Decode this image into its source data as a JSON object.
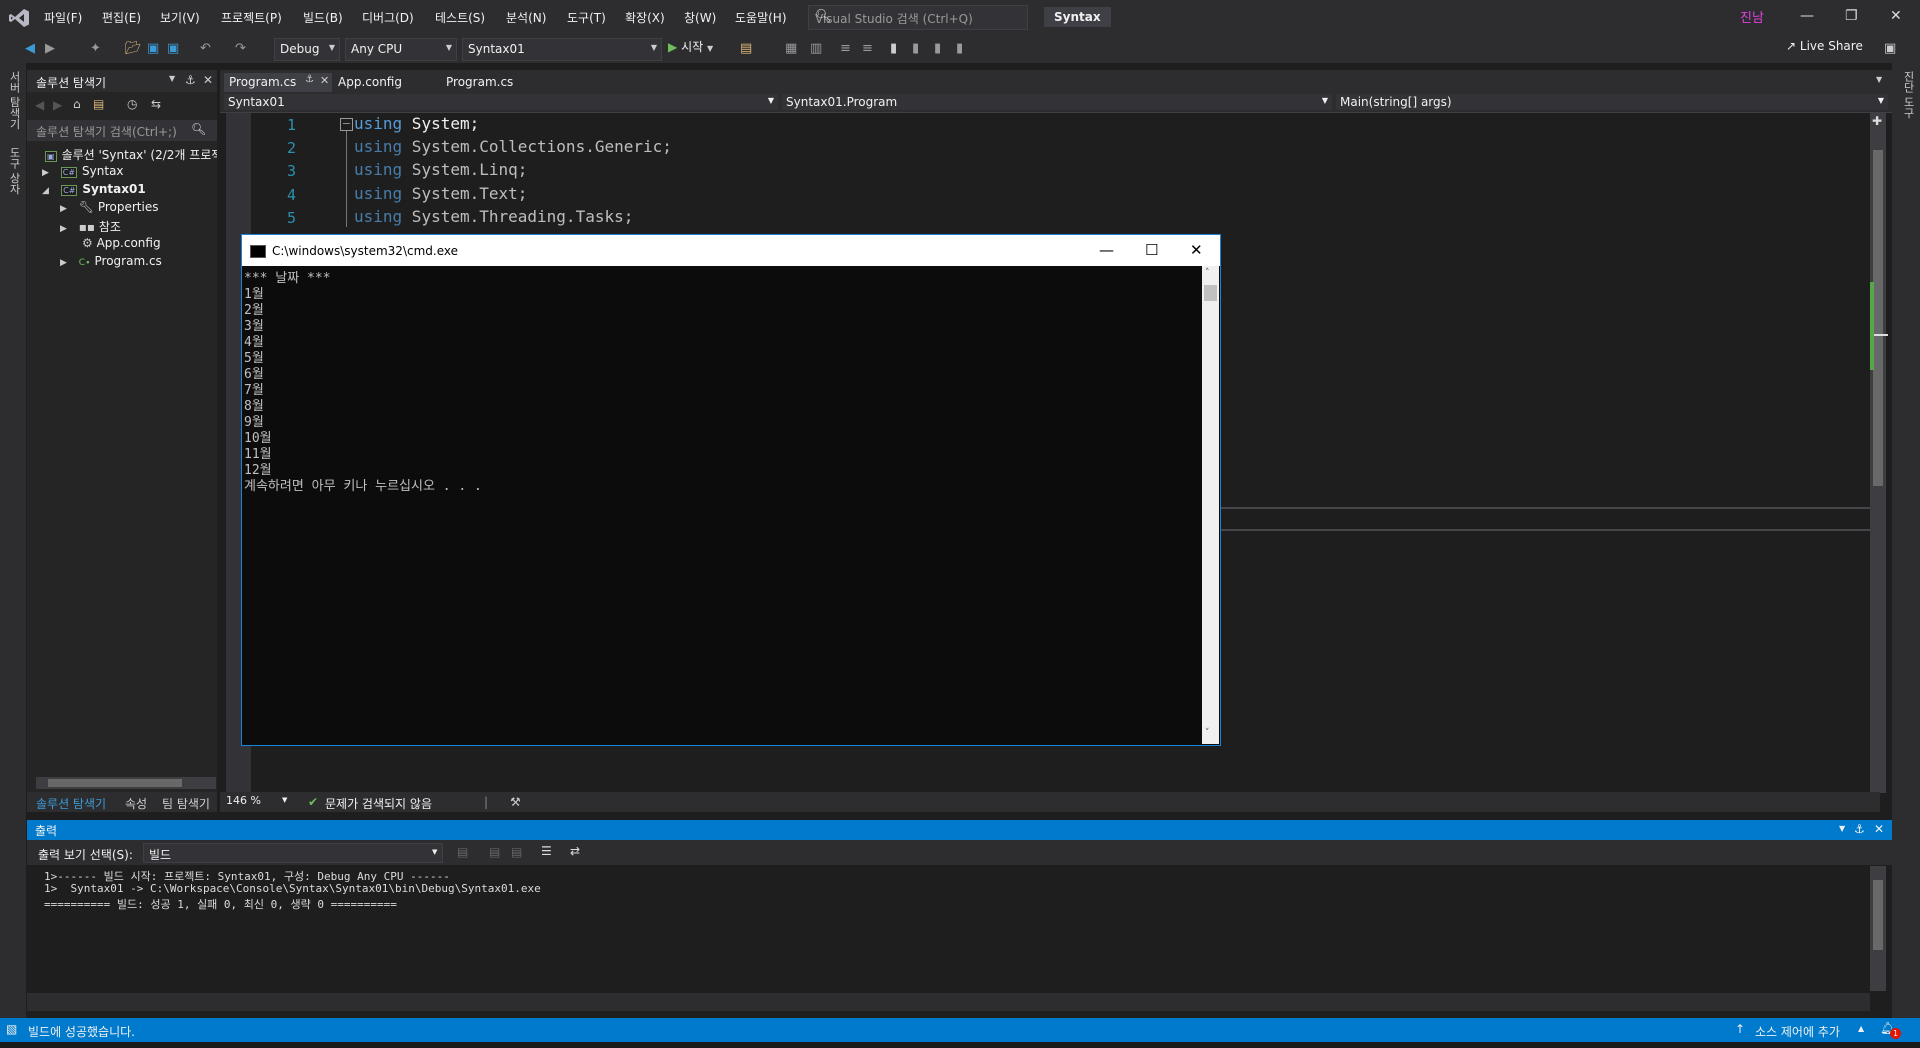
{
  "menu": [
    "파일(F)",
    "편집(E)",
    "보기(V)",
    "프로젝트(P)",
    "빌드(B)",
    "디버그(D)",
    "테스트(S)",
    "분석(N)",
    "도구(T)",
    "확장(X)",
    "창(W)",
    "도움말(H)"
  ],
  "search": {
    "placeholder": "Visual Studio 검색 (Ctrl+Q)"
  },
  "solution_title": "Syntax",
  "user": "진남",
  "toolbar": {
    "config": "Debug",
    "platform": "Any CPU",
    "startup": "Syntax01",
    "start": "시작",
    "live_share": "Live Share"
  },
  "left_strip": [
    "서버 탐색기",
    "도구 상자"
  ],
  "right_strip": [
    "진단 도구"
  ],
  "solution_explorer": {
    "title": "솔루션 탐색기",
    "search_placeholder": "솔루션 탐색기 검색(Ctrl+;)",
    "root": "솔루션 'Syntax' (2/2개 프로젝트)",
    "items": [
      {
        "label": "Syntax",
        "badge": "C#"
      },
      {
        "label": "Syntax01",
        "badge": "C#"
      },
      {
        "label": "Properties"
      },
      {
        "label": "참조"
      },
      {
        "label": "App.config"
      },
      {
        "label": "Program.cs",
        "badge": "C#"
      }
    ],
    "tabs": [
      "솔루션 탐색기",
      "속성",
      "팀 탐색기"
    ]
  },
  "doc_tabs": [
    "Program.cs",
    "App.config",
    "Program.cs"
  ],
  "nav": {
    "project": "Syntax01",
    "type": "Syntax01.Program",
    "member": "Main(string[] args)"
  },
  "code_lines": [
    {
      "n": "1",
      "kw": "using",
      "rest": " System;"
    },
    {
      "n": "2",
      "kw": "using",
      "rest": " System.Collections.Generic;"
    },
    {
      "n": "3",
      "kw": "using",
      "rest": " System.Linq;"
    },
    {
      "n": "4",
      "kw": "using",
      "rest": " System.Text;"
    },
    {
      "n": "5",
      "kw": "using",
      "rest": " System.Threading.Tasks;"
    }
  ],
  "editor_status": {
    "zoom": "146 %",
    "issues": "문제가 검색되지 않음"
  },
  "cmd": {
    "title": "C:\\windows\\system32\\cmd.exe",
    "lines": [
      "*** 날짜 ***",
      "1월",
      "2월",
      "3월",
      "4월",
      "5월",
      "6월",
      "7월",
      "8월",
      "9월",
      "10월",
      "11월",
      "12월",
      "계속하려면 아무 키나 누르십시오 . . ."
    ]
  },
  "output": {
    "title": "출력",
    "select_label": "출력 보기 선택(S):",
    "select_value": "빌드",
    "lines": [
      "1>------ 빌드 시작: 프로젝트: Syntax01, 구성: Debug Any CPU ------",
      "1>  Syntax01 -> C:\\Workspace\\Console\\Syntax\\Syntax01\\bin\\Debug\\Syntax01.exe",
      "========== 빌드: 성공 1, 실패 0, 최신 0, 생략 0 =========="
    ]
  },
  "status": {
    "message": "빌드에 성공했습니다.",
    "source_control": "소스 제어에 추가",
    "notifications": "1"
  }
}
